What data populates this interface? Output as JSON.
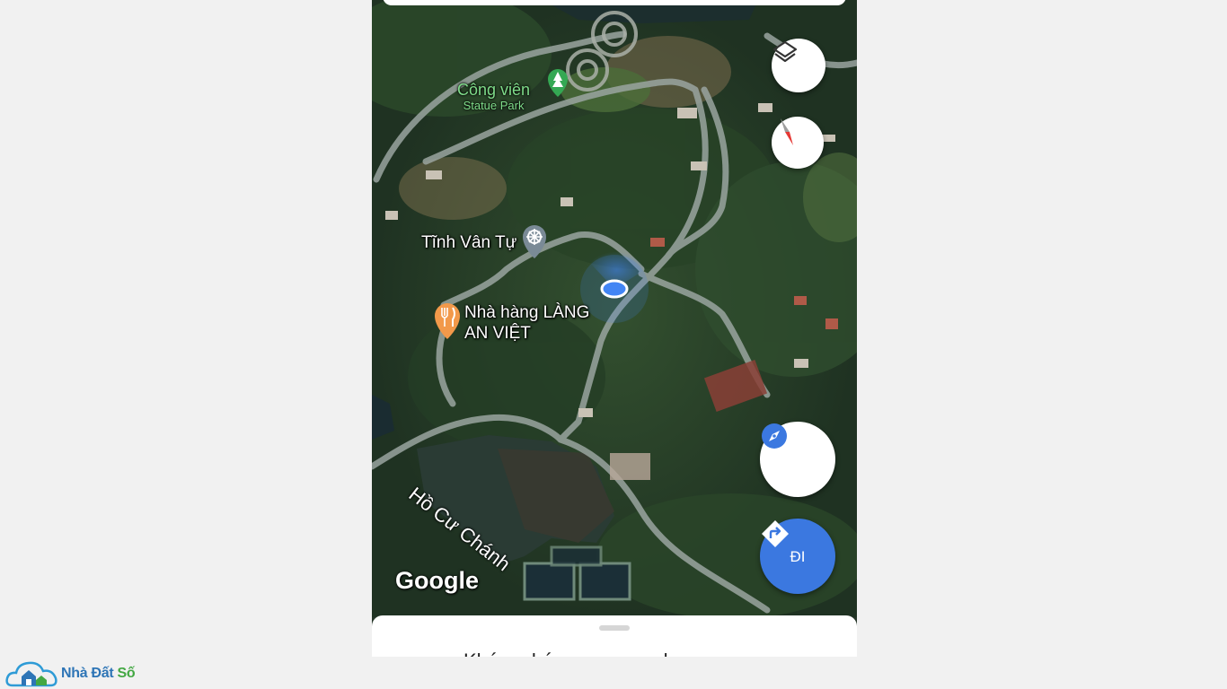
{
  "map": {
    "provider_logo": "Google",
    "places": [
      {
        "name_line1": "Công viên",
        "name_line2": "Statue Park",
        "icon": "tree-icon"
      },
      {
        "name": "Tĩnh Vân Tự",
        "icon": "dharma-wheel-icon"
      },
      {
        "name_line1": "Nhà hàng LÀNG",
        "name_line2": "AN VIỆT",
        "icon": "fork-knife-icon"
      }
    ],
    "lake_name": "Hồ Cư Chánh"
  },
  "controls": {
    "layers_icon": "layers-icon",
    "compass_icon": "compass-needle-icon",
    "locate_icon": "explore-icon",
    "go_label": "ĐI",
    "go_icon": "directions-icon"
  },
  "bottom_sheet": {
    "partial_text": "Khám phá ... ung quanh"
  },
  "watermark": {
    "brand_prefix": "Nhà Đất",
    "brand_suffix": "Số"
  },
  "colors": {
    "accent_blue": "#3b78e0",
    "location_dot": "#4285f4",
    "compass_red": "#e53935",
    "park_green": "#7fdc8a",
    "restaurant_orange": "#f2994a"
  }
}
